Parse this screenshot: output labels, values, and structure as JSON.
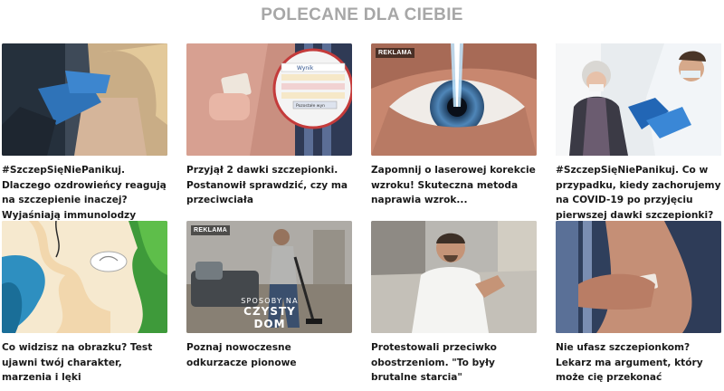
{
  "section": {
    "heading": "POLECANE DLA CIEBIE"
  },
  "cards": [
    {
      "caption": "#SzczepSięNiePanikuj. Dlaczego ozdrowieńcy reagują na szczepienie inaczej? Wyjaśniają immunolodzy",
      "image": "vaccination-gloved-hands-photo"
    },
    {
      "caption": "Przyjął 2 dawki szczepionki. Postanowił sprawdzić, czy ma przeciwciała",
      "image": "plaster-on-arm-photo",
      "thumb_texts": [
        "Wynik",
        "Pozostałe wyn"
      ]
    },
    {
      "caption": "Zapomnij o laserowej korekcie wzroku! Skuteczna metoda naprawia wzrok...",
      "image": "laser-eye-photo",
      "badge": "REKLAMA"
    },
    {
      "caption": "#SzczepSięNiePanikuj. Co w przypadku, kiedy zachorujemy na COVID-19 po przyjęciu pierwszej dawki szczepionki?",
      "image": "elderly-woman-vaccination-photo"
    },
    {
      "caption": "Co widzisz na obrazku? Test ujawni twój charakter, marzenia i lęki",
      "image": "optical-illusion-illustration"
    },
    {
      "caption": "Poznaj nowoczesne odkurzacze pionowe",
      "image": "vacuum-living-room-photo",
      "badge": "REKLAMA",
      "overlay_line1": "SPOSOBY NA",
      "overlay_line2": "CZYSTY DOM"
    },
    {
      "caption": "Protestowali przeciwko obostrzeniom. \"To były brutalne starcia\"",
      "image": "monk-speaking-photo"
    },
    {
      "caption": "Nie ufasz szczepionkom? Lekarz ma argument, który może cię przekonać",
      "image": "arm-bandage-photo"
    }
  ]
}
